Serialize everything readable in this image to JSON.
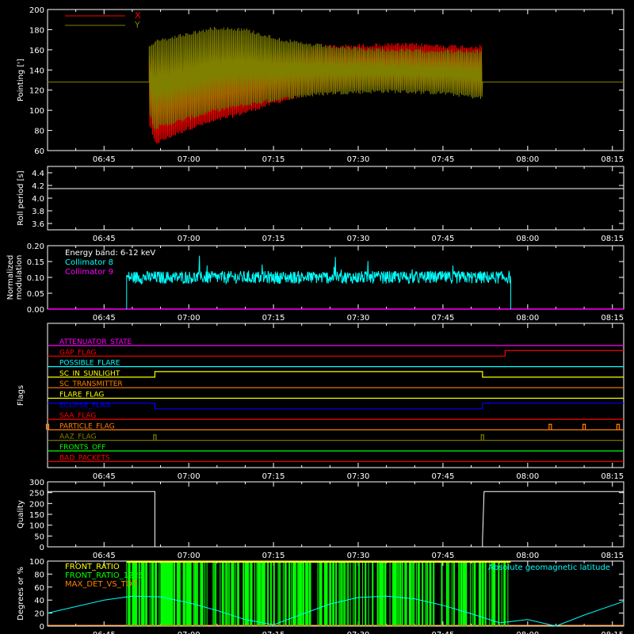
{
  "time_ticks": [
    "06:45",
    "07:00",
    "07:15",
    "07:30",
    "07:45",
    "08:00",
    "08:15"
  ],
  "chart_data": [
    {
      "type": "line",
      "ylabel": "Pointing [']",
      "ylim": [
        60,
        200
      ],
      "yticks": [
        60,
        80,
        100,
        120,
        140,
        160,
        180,
        200
      ],
      "xlim": [
        "06:35",
        "08:17"
      ],
      "grid": false,
      "legend_position": "top-left",
      "series": [
        {
          "name": "X",
          "color": "#ff0000",
          "x": [
            "06:35",
            "06:53",
            "06:54",
            "07:00",
            "07:05",
            "07:10",
            "07:15",
            "07:20",
            "07:25",
            "07:30",
            "07:35",
            "07:40",
            "07:45",
            "07:48",
            "07:52",
            "07:52",
            "08:17"
          ],
          "upper": [
            128,
            155,
            150,
            148,
            150,
            153,
            158,
            162,
            165,
            166,
            167,
            167,
            166,
            165,
            165,
            128,
            128
          ],
          "lower": [
            128,
            85,
            65,
            80,
            88,
            96,
            105,
            113,
            118,
            120,
            122,
            121,
            120,
            120,
            115,
            128,
            128
          ]
        },
        {
          "name": "Y",
          "color": "#808000",
          "x": [
            "06:35",
            "06:53",
            "06:54",
            "07:00",
            "07:05",
            "07:10",
            "07:15",
            "07:20",
            "07:25",
            "07:30",
            "07:35",
            "07:40",
            "07:45",
            "07:48",
            "07:52",
            "07:52",
            "08:17"
          ],
          "upper": [
            128,
            165,
            170,
            178,
            184,
            182,
            174,
            168,
            165,
            163,
            162,
            161,
            161,
            160,
            160,
            128,
            128
          ],
          "lower": [
            128,
            95,
            80,
            90,
            98,
            103,
            108,
            112,
            115,
            116,
            117,
            116,
            115,
            113,
            110,
            128,
            128
          ]
        }
      ]
    },
    {
      "type": "line",
      "ylabel": "Roll period [s]",
      "ylim": [
        3.5,
        4.5
      ],
      "yticks": [
        3.6,
        3.8,
        4.0,
        4.2,
        4.4
      ],
      "xlim": [
        "06:35",
        "08:17"
      ],
      "series": [
        {
          "name": "",
          "color": "#ffffff",
          "x": [
            "06:35",
            "08:17"
          ],
          "y": [
            4.15,
            4.15
          ]
        }
      ]
    },
    {
      "type": "line",
      "ylabel": "Normalized modulation",
      "ylim": [
        0,
        0.2
      ],
      "yticks": [
        0.0,
        0.05,
        0.1,
        0.15,
        0.2
      ],
      "xlim": [
        "06:35",
        "08:17"
      ],
      "annotation": "Energy band: 6-12 keV",
      "series": [
        {
          "name": "Collimator 8",
          "color": "#00ffff",
          "x_start": "06:49",
          "x_end": "07:57",
          "mean": 0.1,
          "spread": 0.02,
          "max": 0.17
        },
        {
          "name": "Collimator 9",
          "color": "#ff00ff",
          "x": [
            "06:35",
            "08:17"
          ],
          "y": [
            0,
            0
          ]
        }
      ]
    },
    {
      "type": "line",
      "ylabel": "Flags",
      "xlim": [
        "06:35",
        "08:17"
      ],
      "series": [
        {
          "name": "ATTENUATOR_STATE",
          "color": "#ff00ff",
          "steps": []
        },
        {
          "name": "GAP_FLAG",
          "color": "#ff0000",
          "steps": [
            [
              "07:56",
              1
            ]
          ]
        },
        {
          "name": "POSSIBLE_FLARE",
          "color": "#00ffff",
          "steps": []
        },
        {
          "name": "SC_IN_SUNLIGHT",
          "color": "#ffff00",
          "steps": [
            [
              "06:54",
              1
            ],
            [
              "07:52",
              0
            ]
          ]
        },
        {
          "name": "SC_TRANSMITTER",
          "color": "#ff8000",
          "steps": []
        },
        {
          "name": "FLARE_FLAG",
          "color": "#ffff00",
          "steps": []
        },
        {
          "name": "ECLIPSE_FLAG",
          "color": "#0000ff",
          "steps": [
            [
              "06:35",
              1
            ],
            [
              "06:54",
              0
            ],
            [
              "07:52",
              1
            ]
          ]
        },
        {
          "name": "SAA_FLAG",
          "color": "#ff0000",
          "steps": []
        },
        {
          "name": "PARTICLE_FLAG",
          "color": "#ff8000",
          "spikes": [
            "06:35",
            "08:04",
            "08:10",
            "08:16"
          ]
        },
        {
          "name": "AAZ_FLAG",
          "color": "#808000",
          "spikes": [
            "06:54",
            "07:52"
          ]
        },
        {
          "name": "FRONTS_OFF",
          "color": "#00ff00",
          "steps": []
        },
        {
          "name": "BAD_PACKETS",
          "color": "#ff0000",
          "steps": []
        }
      ]
    },
    {
      "type": "line",
      "ylabel": "Quality",
      "ylim": [
        0,
        300
      ],
      "yticks": [
        0,
        50,
        100,
        150,
        200,
        250,
        300
      ],
      "xlim": [
        "06:35",
        "08:17"
      ],
      "series": [
        {
          "name": "",
          "color": "#ffffff",
          "x": [
            "06:35",
            "06:54",
            "06:54",
            "07:52",
            "07:52",
            "07:52",
            "08:17"
          ],
          "y": [
            255,
            255,
            0,
            0,
            30,
            255,
            255
          ]
        }
      ]
    },
    {
      "type": "line",
      "ylabel": "Degrees or %",
      "ylim": [
        0,
        100
      ],
      "yticks": [
        0,
        20,
        40,
        60,
        80,
        100
      ],
      "xlim": [
        "06:35",
        "08:17"
      ],
      "series": [
        {
          "name": "FRONT_RATIO",
          "color": "#ffff00",
          "x_start": "06:49",
          "x_end": "07:57",
          "level": 100
        },
        {
          "name": "FRONT_RATIO_1225",
          "color": "#00ff00",
          "x_start": "06:49",
          "x_end": "07:57",
          "level": 100
        },
        {
          "name": "MAX_DET_VS_TOT",
          "color": "#ff8000",
          "x_start": "06:49",
          "x_end": "07:57",
          "level": 100
        },
        {
          "name": "Absolute geomagnetic latitude",
          "color": "#00ffff",
          "x": [
            "06:35",
            "06:45",
            "06:50",
            "06:55",
            "07:00",
            "07:05",
            "07:10",
            "07:15",
            "07:20",
            "07:25",
            "07:30",
            "07:35",
            "07:40",
            "07:45",
            "07:50",
            "07:55",
            "08:00",
            "08:05",
            "08:10",
            "08:17"
          ],
          "y": [
            20,
            40,
            46,
            45,
            36,
            24,
            10,
            2,
            18,
            34,
            44,
            46,
            42,
            32,
            19,
            5,
            10,
            0,
            17,
            38
          ]
        }
      ]
    }
  ]
}
